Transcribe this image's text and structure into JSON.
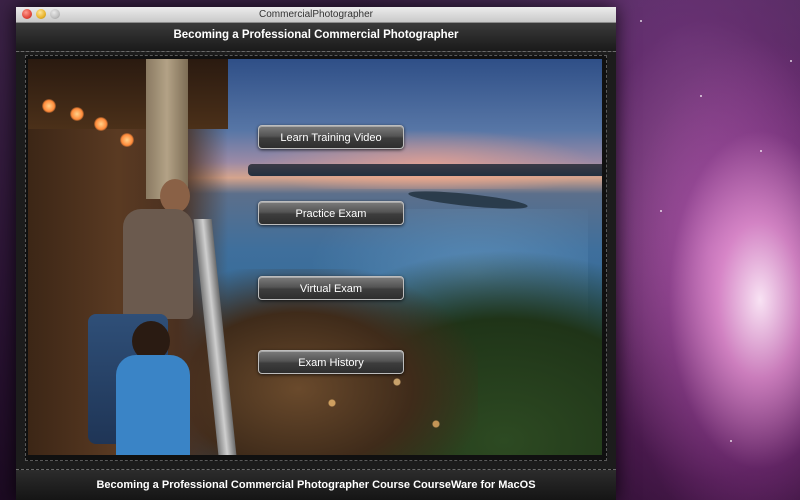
{
  "window": {
    "title": "CommercialPhotographer"
  },
  "header": {
    "title": "Becoming a Professional Commercial Photographer"
  },
  "menu": {
    "buttons": [
      {
        "label": "Learn Training Video"
      },
      {
        "label": "Practice Exam"
      },
      {
        "label": "Virtual Exam"
      },
      {
        "label": "Exam History"
      }
    ]
  },
  "footer": {
    "text": "Becoming a Professional Commercial Photographer Course CourseWare for MacOS"
  },
  "icons": {
    "close": "close-window-icon",
    "minimize": "minimize-window-icon",
    "zoom": "zoom-window-icon"
  },
  "colors": {
    "window_chrome": "#1c1c1c",
    "button_border": "#bdbdbd",
    "text": "#ffffff",
    "close": "#e0463a",
    "minimize": "#e8b32a"
  }
}
